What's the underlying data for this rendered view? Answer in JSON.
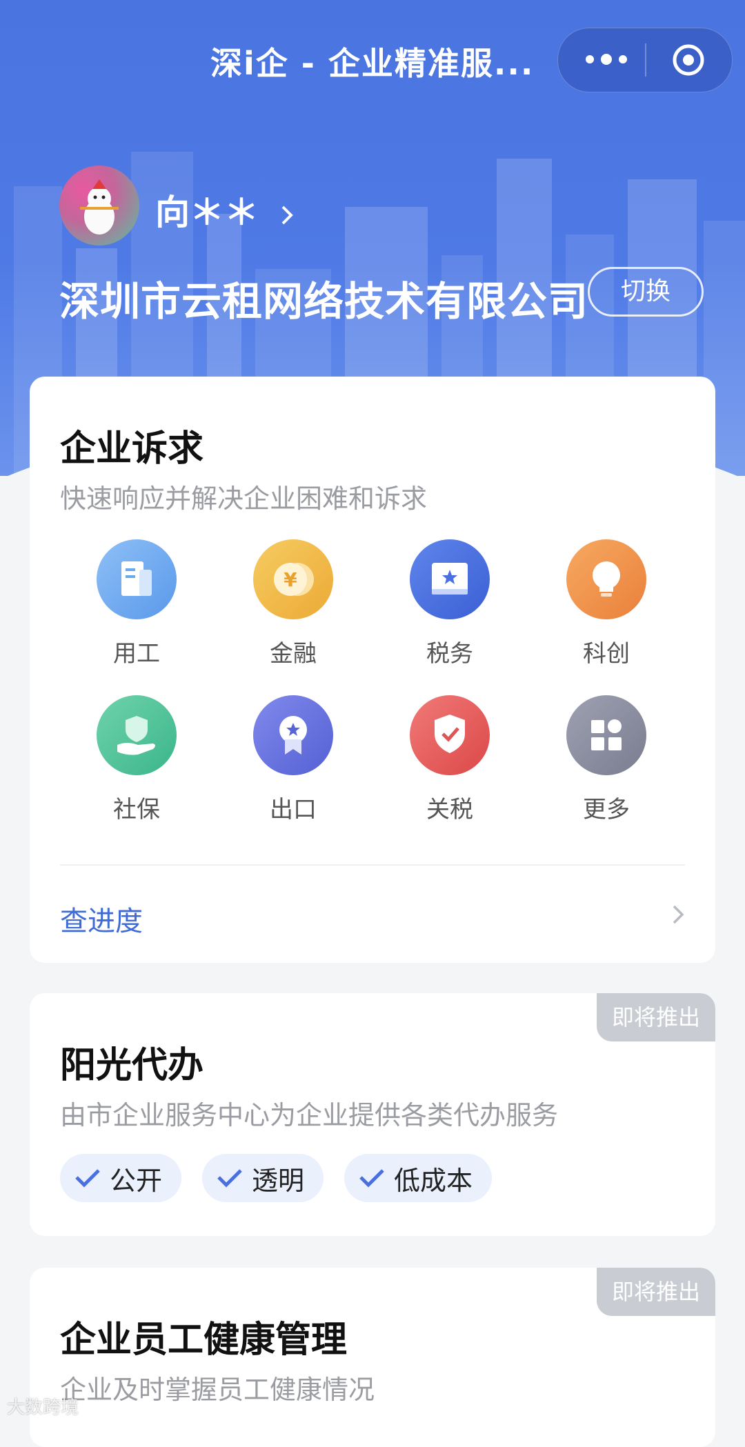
{
  "header": {
    "app_title": "深i企 - 企业精准服...",
    "username": "向＊＊",
    "company_name": "深圳市云租网络技术有限公司",
    "switch_label": "切换"
  },
  "demands_card": {
    "title": "企业诉求",
    "subtitle": "快速响应并解决企业困难和诉求",
    "items": [
      {
        "label": "用工",
        "icon": "document-icon",
        "color": "#6aa8f0"
      },
      {
        "label": "金融",
        "icon": "coin-icon",
        "color": "#f0b540"
      },
      {
        "label": "税务",
        "icon": "tax-book-icon",
        "color": "#4a6fe0"
      },
      {
        "label": "科创",
        "icon": "lightbulb-icon",
        "color": "#f09048"
      },
      {
        "label": "社保",
        "icon": "hand-shield-icon",
        "color": "#4cc49a"
      },
      {
        "label": "出口",
        "icon": "medal-icon",
        "color": "#6672de"
      },
      {
        "label": "关税",
        "icon": "check-shield-icon",
        "color": "#e85858"
      },
      {
        "label": "更多",
        "icon": "grid-more-icon",
        "color": "#8c8fa0"
      }
    ],
    "progress_link": "查进度"
  },
  "agency_card": {
    "badge": "即将推出",
    "title": "阳光代办",
    "subtitle": "由市企业服务中心为企业提供各类代办服务",
    "tags": [
      "公开",
      "透明",
      "低成本"
    ]
  },
  "health_card": {
    "badge": "即将推出",
    "title": "企业员工健康管理",
    "subtitle": "企业及时掌握员工健康情况"
  },
  "watermark": "大数跨境"
}
